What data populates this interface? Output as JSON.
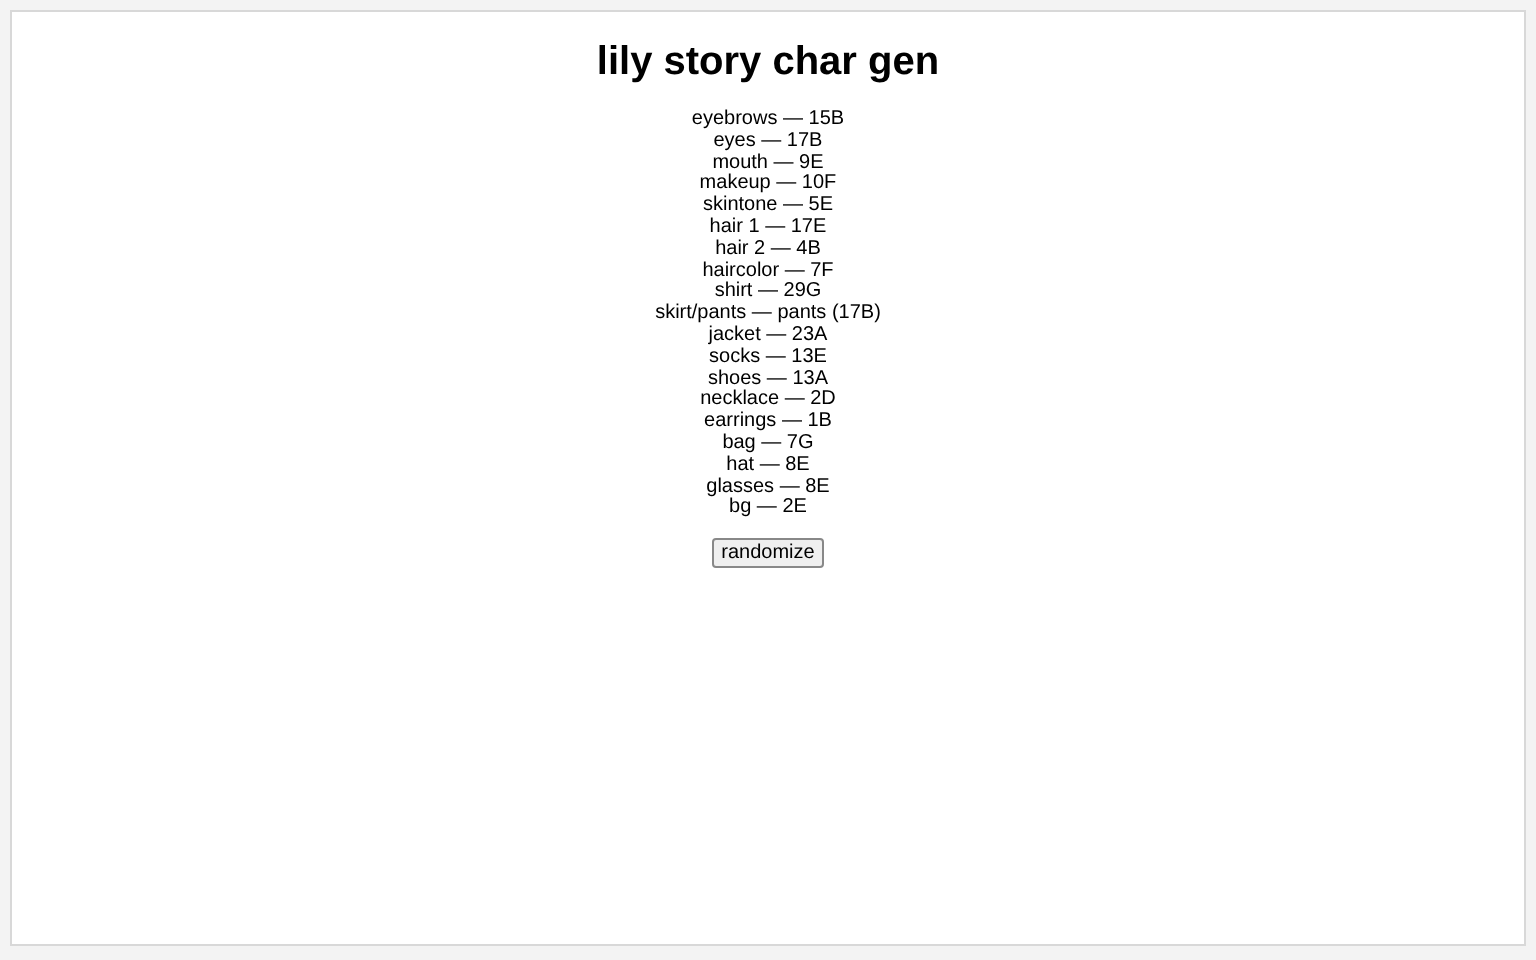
{
  "title": "lily story char gen",
  "lines": [
    "eyebrows — 15B",
    "eyes — 17B",
    "mouth — 9E",
    "makeup — 10F",
    "skintone — 5E",
    "hair 1 — 17E",
    "hair 2 — 4B",
    "haircolor — 7F",
    "shirt — 29G",
    "skirt/pants — pants (17B)",
    "jacket — 23A",
    "socks — 13E",
    "shoes — 13A",
    "necklace — 2D",
    "earrings — 1B",
    "bag — 7G",
    "hat — 8E",
    "glasses — 8E",
    "bg — 2E"
  ],
  "button": "randomize"
}
